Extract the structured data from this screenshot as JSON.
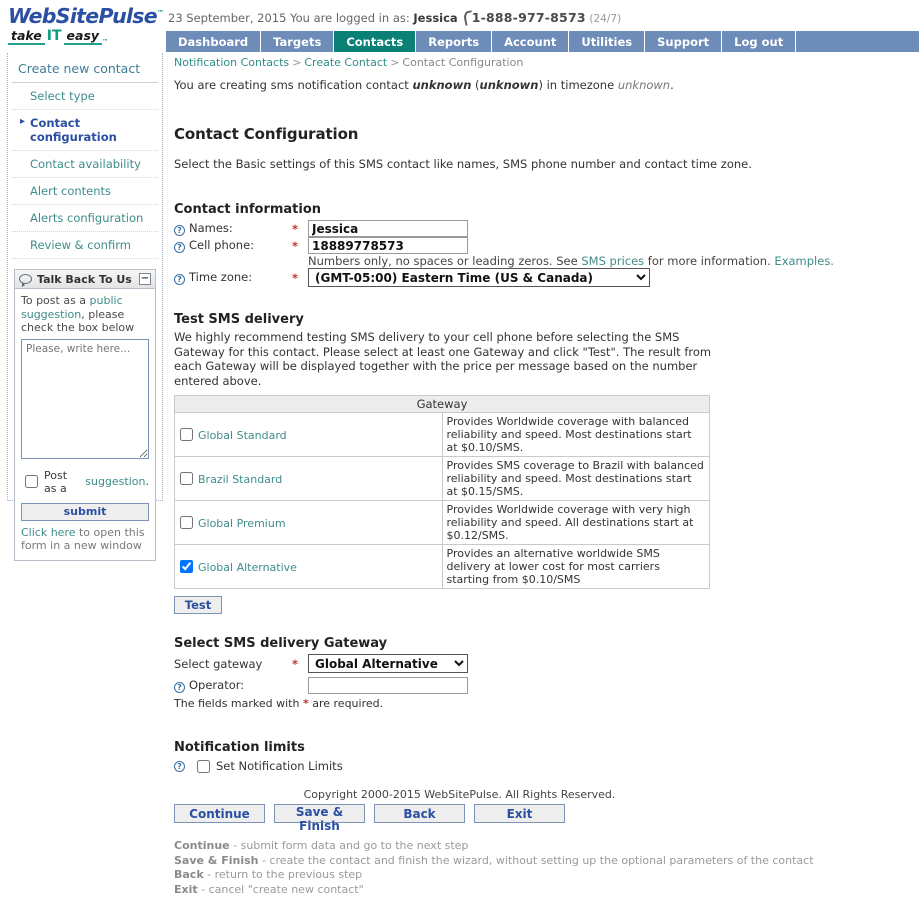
{
  "brand": {
    "name": "WebSitePulse",
    "tm": "™",
    "tagline_1": "take",
    "tagline_it": "IT",
    "tagline_2": "easy",
    "tagline_tm": "™",
    "logo_color": "#2b4fa2",
    "accent_color": "#20a08a"
  },
  "header": {
    "date": "23 September, 2015",
    "logged_in_prefix": "You are logged in as:",
    "user": "Jessica",
    "phone": "1-888-977-8573",
    "support_hours": "(24/7)"
  },
  "nav": {
    "active": "Contacts",
    "items": [
      {
        "label": "Dashboard"
      },
      {
        "label": "Targets"
      },
      {
        "label": "Contacts"
      },
      {
        "label": "Reports"
      },
      {
        "label": "Account"
      },
      {
        "label": "Utilities"
      },
      {
        "label": "Support"
      },
      {
        "label": "Log out"
      }
    ]
  },
  "breadcrumb": {
    "item1": "Notification Contacts",
    "item2": "Create Contact",
    "current": "Contact Configuration",
    "separator": ">"
  },
  "sidebar": {
    "title": "Create new contact",
    "steps": [
      {
        "label": "Select type",
        "active": false
      },
      {
        "label": "Contact configuration",
        "active": true
      },
      {
        "label": "Contact availability",
        "active": false
      },
      {
        "label": "Alert contents",
        "active": false
      },
      {
        "label": "Alerts configuration",
        "active": false
      },
      {
        "label": "Review & confirm",
        "active": false
      }
    ],
    "talkback": {
      "title": "Talk Back To Us",
      "collapse_label": "−",
      "intro_a": "To post as a ",
      "intro_link": "public suggestion",
      "intro_b": ", please check the box below",
      "textarea_placeholder": "Please, write here...",
      "textarea_value": "",
      "checkbox_label_a": "Post as a ",
      "checkbox_link": "suggestion",
      "checkbox_label_b": ".",
      "checkbox_checked": false,
      "submit_label": "submit",
      "foot_link": "Click here",
      "foot_text": " to open this form in a new window"
    }
  },
  "main": {
    "lead": {
      "part1": "You are creating sms notification contact ",
      "name": "unknown",
      "part2": " (",
      "type": "unknown",
      "part3": ") in timezone ",
      "timezone": "unknown",
      "part4": "."
    },
    "page_title": "Contact Configuration",
    "page_subtitle": "Select the Basic settings of this SMS contact like names, SMS phone number and contact time zone.",
    "contact_information": {
      "heading": "Contact information",
      "names_label": "Names:",
      "names_value": "Jessica",
      "cell_label": "Cell phone:",
      "cell_value": "18889778573",
      "cell_hint_a": "Numbers only, no spaces or leading zeros. See ",
      "cell_hint_link1": "SMS prices",
      "cell_hint_b": " for more information. ",
      "cell_hint_link2": "Examples.",
      "timezone_label": "Time zone:",
      "timezone_value": "(GMT-05:00) Eastern Time (US & Canada)",
      "timezone_options": [
        "(GMT-05:00) Eastern Time (US & Canada)"
      ],
      "required_star": "*"
    },
    "test_sms": {
      "heading": "Test SMS delivery",
      "paragraph": "We highly recommend testing SMS delivery to your cell phone before selecting the SMS Gateway for this contact. Please select at least one Gateway and click \"Test\". The result from each Gateway will be displayed together with the price per message based on the number entered above.",
      "table_header": "Gateway",
      "rows": [
        {
          "name": "Global Standard",
          "checked": false,
          "description": "Provides Worldwide coverage with balanced reliability and speed. Most destinations start at $0.10/SMS."
        },
        {
          "name": "Brazil Standard",
          "checked": false,
          "description": "Provides SMS coverage to Brazil with balanced reliability and speed. Most destinations start at $0.15/SMS."
        },
        {
          "name": "Global Premium",
          "checked": false,
          "description": "Provides Worldwide coverage with very high reliability and speed. All destinations start at $0.12/SMS."
        },
        {
          "name": "Global Alternative",
          "checked": true,
          "description": "Provides an alternative worldwide SMS delivery at lower cost for most carriers starting from $0.10/SMS"
        }
      ],
      "test_button": "Test"
    },
    "select_gateway": {
      "heading": "Select SMS delivery Gateway",
      "gateway_label": "Select gateway",
      "gateway_value": "Global Alternative",
      "gateway_options": [
        "Global Standard",
        "Brazil Standard",
        "Global Premium",
        "Global Alternative"
      ],
      "operator_label": "Operator:",
      "operator_value": "",
      "required_note_a": "The fields marked with ",
      "required_note_star": "*",
      "required_note_b": " are required."
    },
    "notification_limits": {
      "heading": "Notification limits",
      "checkbox_label": "Set Notification Limits",
      "checked": false
    },
    "buttons": [
      {
        "label": "Continue"
      },
      {
        "label": "Save & Finish"
      },
      {
        "label": "Back"
      },
      {
        "label": "Exit"
      }
    ],
    "legend": [
      {
        "term": "Continue",
        "desc": " - submit form data and go to the next step"
      },
      {
        "term": "Save & Finish",
        "desc": " - create the contact and finish the wizard, without setting up the optional parameters of the contact"
      },
      {
        "term": "Back",
        "desc": " - return to the previous step"
      },
      {
        "term": "Exit",
        "desc": " - cancel \"create new contact\""
      }
    ]
  },
  "footer": {
    "copyright": "Copyright 2000-2015 WebSitePulse. All Rights Reserved."
  },
  "icons": {
    "help": "?",
    "phone": "phone-handset-icon",
    "bubble": "speech-bubble-icon",
    "caret": "chevron-down-icon"
  }
}
